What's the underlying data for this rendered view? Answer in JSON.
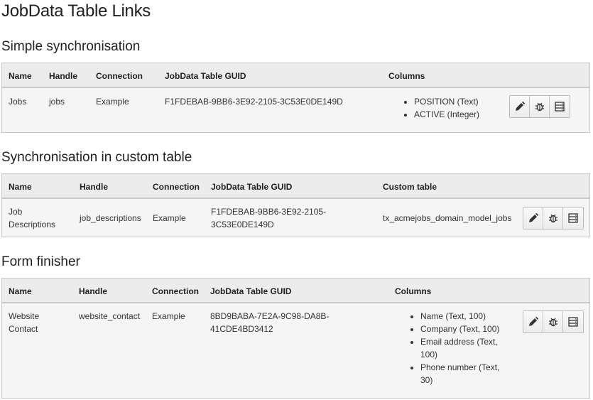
{
  "page": {
    "title": "JobData Table Links"
  },
  "sections": [
    {
      "title": "Simple synchronisation",
      "headers": [
        "Name",
        "Handle",
        "Connection",
        "JobData Table GUID",
        "Columns"
      ],
      "row": {
        "name": "Jobs",
        "handle": "jobs",
        "connection": "Example",
        "guid": "F1FDEBAB-9BB6-3E92-2105-3C53E0DE149D",
        "columns": [
          "POSITION (Text)",
          "ACTIVE (Integer)"
        ]
      }
    },
    {
      "title": "Synchronisation in custom table",
      "headers": [
        "Name",
        "Handle",
        "Connection",
        "JobData Table GUID",
        "Custom table"
      ],
      "row": {
        "name_line1": "Job",
        "name_line2": "Descriptions",
        "handle": "job_descriptions",
        "connection": "Example",
        "guid_line1": "F1FDEBAB-9BB6-3E92-2105-",
        "guid_line2": "3C53E0DE149D",
        "custom_table": "tx_acmejobs_domain_model_jobs"
      }
    },
    {
      "title": "Form finisher",
      "headers": [
        "Name",
        "Handle",
        "Connection",
        "JobData Table GUID",
        "Columns"
      ],
      "row": {
        "name_line1": "Website",
        "name_line2": "Contact",
        "handle": "website_contact",
        "connection": "Example",
        "guid_line1": "8BD9BABA-7E2A-9C98-DA8B-",
        "guid_line2": "41CDE4BD3412",
        "columns": [
          {
            "line1": "Name (Text, 100)",
            "line2": ""
          },
          {
            "line1": "Company (Text, 100)",
            "line2": ""
          },
          {
            "line1": "Email address (Text,",
            "line2": "100)"
          },
          {
            "line1": "Phone number (Text,",
            "line2": "30)"
          }
        ]
      }
    }
  ],
  "actions": {
    "edit_icon": "pencil-icon",
    "debug_icon": "bug-icon",
    "records_icon": "table-records-icon"
  }
}
